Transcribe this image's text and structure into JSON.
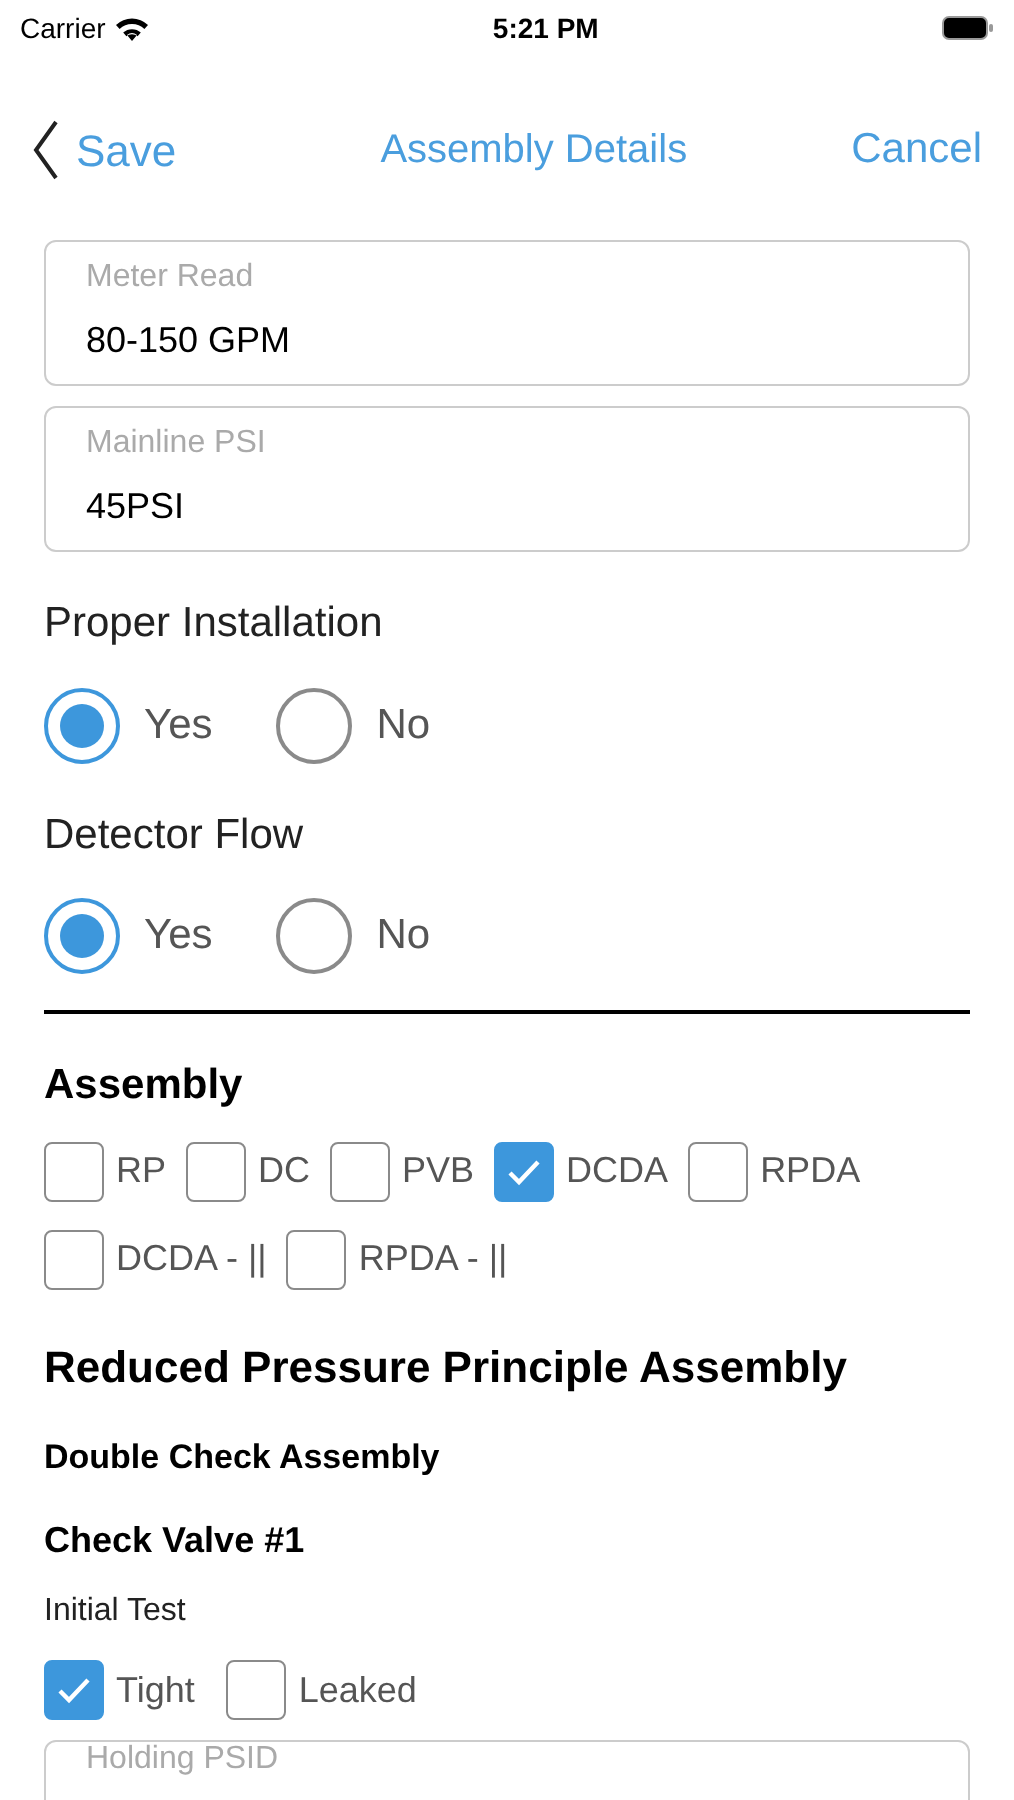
{
  "status_bar": {
    "carrier": "Carrier",
    "time": "5:21 PM"
  },
  "nav": {
    "back": "Save",
    "title": "Assembly Details",
    "action": "Cancel"
  },
  "fields": [
    {
      "label": "Meter Read",
      "value": "80-150 GPM"
    },
    {
      "label": "Mainline PSI",
      "value": "45PSI"
    }
  ],
  "radio_groups": [
    {
      "label": "Proper Installation",
      "options": [
        {
          "label": "Yes",
          "selected": true
        },
        {
          "label": "No",
          "selected": false
        }
      ]
    },
    {
      "label": "Detector Flow",
      "options": [
        {
          "label": "Yes",
          "selected": true
        },
        {
          "label": "No",
          "selected": false
        }
      ]
    }
  ],
  "assembly": {
    "title": "Assembly",
    "options": [
      {
        "label": "RP",
        "checked": false
      },
      {
        "label": "DC",
        "checked": false
      },
      {
        "label": "PVB",
        "checked": false
      },
      {
        "label": "DCDA",
        "checked": true
      },
      {
        "label": "RPDA",
        "checked": false
      },
      {
        "label": "DCDA - ||",
        "checked": false
      },
      {
        "label": "RPDA - ||",
        "checked": false
      }
    ]
  },
  "section_title": "Reduced Pressure Principle Assembly",
  "subsection_title": "Double Check Assembly",
  "check_valve": {
    "title": "Check Valve #1",
    "test_label": "Initial Test",
    "options": [
      {
        "label": "Tight",
        "checked": true
      },
      {
        "label": "Leaked",
        "checked": false
      }
    ],
    "field": {
      "label": "Holding PSID"
    }
  }
}
